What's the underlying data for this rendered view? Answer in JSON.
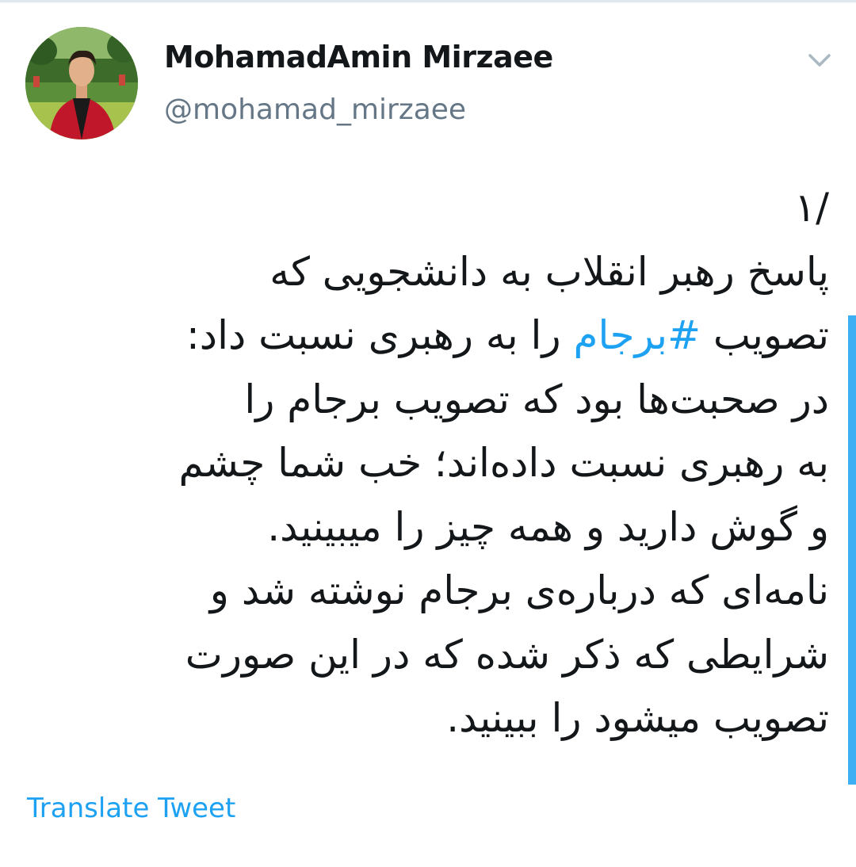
{
  "tweet": {
    "author_name": "MohamadAmin  Mirzaee",
    "author_handle": "@mohamad_mirzaee",
    "lines": [
      "/۱",
      "پاسخ رهبر انقلاب به دانشجویی که",
      {
        "before": "تصویب ",
        "hashtag": "#برجام",
        "after": " را به رهبری نسبت داد:"
      },
      "در صحبت‌ها بود که تصویب برجام را",
      "به رهبری نسبت داده‌اند؛ خب شما چشم",
      "و گوش دارید و همه چیز را میبینید.",
      "نامه‌ای که درباره‌ی برجام نوشته شد و",
      "شرایطی که ذکر شده که در این صورت",
      "تصویب میشود را ببینید."
    ]
  },
  "actions": {
    "translate_label": "Translate Tweet",
    "menu_icon": "chevron-down-icon"
  },
  "colors": {
    "accent": "#1da1f2",
    "text": "#14171a",
    "secondary": "#657786"
  }
}
